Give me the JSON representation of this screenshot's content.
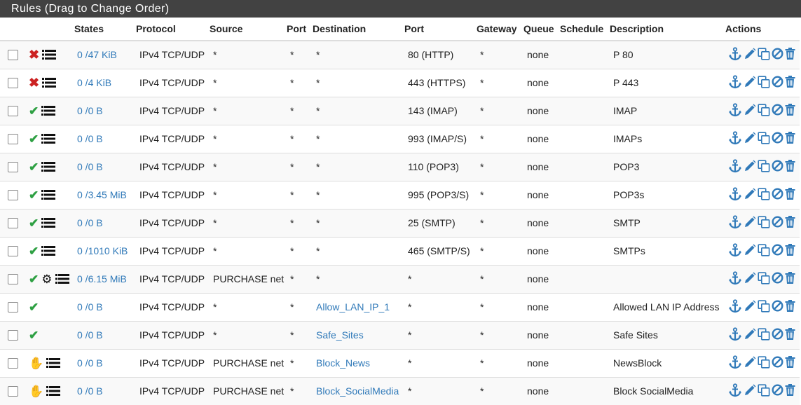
{
  "panel": {
    "title": "Rules (Drag to Change Order)"
  },
  "columns": [
    "States",
    "Protocol",
    "Source",
    "Port",
    "Destination",
    "Port",
    "Gateway",
    "Queue",
    "Schedule",
    "Description",
    "Actions"
  ],
  "icons": {
    "block": "x-mark-icon",
    "pass": "check-icon",
    "reject": "hand-icon",
    "log": "list-icon",
    "advanced": "gear-icon",
    "anchor": "anchor-icon",
    "edit": "pencil-icon",
    "copy": "copy-icon",
    "disable": "ban-icon",
    "delete": "trash-icon"
  },
  "colors": {
    "link": "#317ab9",
    "block": "#cc2222",
    "pass": "#2ea043",
    "reject": "#f0c000",
    "header_bg": "#424242"
  },
  "rules": [
    {
      "action": "block",
      "log": true,
      "gear": false,
      "states": "0 /47 KiB",
      "protocol": "IPv4 TCP/UDP",
      "source": "*",
      "sport": "*",
      "destination": "*",
      "dest_link": false,
      "dport": "80 (HTTP)",
      "gateway": "*",
      "queue": "none",
      "schedule": "",
      "description": "P 80"
    },
    {
      "action": "block",
      "log": true,
      "gear": false,
      "states": "0 /4 KiB",
      "protocol": "IPv4 TCP/UDP",
      "source": "*",
      "sport": "*",
      "destination": "*",
      "dest_link": false,
      "dport": "443 (HTTPS)",
      "gateway": "*",
      "queue": "none",
      "schedule": "",
      "description": "P 443"
    },
    {
      "action": "pass",
      "log": true,
      "gear": false,
      "states": "0 /0 B",
      "protocol": "IPv4 TCP/UDP",
      "source": "*",
      "sport": "*",
      "destination": "*",
      "dest_link": false,
      "dport": "143 (IMAP)",
      "gateway": "*",
      "queue": "none",
      "schedule": "",
      "description": "IMAP"
    },
    {
      "action": "pass",
      "log": true,
      "gear": false,
      "states": "0 /0 B",
      "protocol": "IPv4 TCP/UDP",
      "source": "*",
      "sport": "*",
      "destination": "*",
      "dest_link": false,
      "dport": "993 (IMAP/S)",
      "gateway": "*",
      "queue": "none",
      "schedule": "",
      "description": "IMAPs"
    },
    {
      "action": "pass",
      "log": true,
      "gear": false,
      "states": "0 /0 B",
      "protocol": "IPv4 TCP/UDP",
      "source": "*",
      "sport": "*",
      "destination": "*",
      "dest_link": false,
      "dport": "110 (POP3)",
      "gateway": "*",
      "queue": "none",
      "schedule": "",
      "description": "POP3"
    },
    {
      "action": "pass",
      "log": true,
      "gear": false,
      "states": "0 /3.45 MiB",
      "protocol": "IPv4 TCP/UDP",
      "source": "*",
      "sport": "*",
      "destination": "*",
      "dest_link": false,
      "dport": "995 (POP3/S)",
      "gateway": "*",
      "queue": "none",
      "schedule": "",
      "description": "POP3s"
    },
    {
      "action": "pass",
      "log": true,
      "gear": false,
      "states": "0 /0 B",
      "protocol": "IPv4 TCP/UDP",
      "source": "*",
      "sport": "*",
      "destination": "*",
      "dest_link": false,
      "dport": "25 (SMTP)",
      "gateway": "*",
      "queue": "none",
      "schedule": "",
      "description": "SMTP"
    },
    {
      "action": "pass",
      "log": true,
      "gear": false,
      "states": "0 /1010 KiB",
      "protocol": "IPv4 TCP/UDP",
      "source": "*",
      "sport": "*",
      "destination": "*",
      "dest_link": false,
      "dport": "465 (SMTP/S)",
      "gateway": "*",
      "queue": "none",
      "schedule": "",
      "description": "SMTPs"
    },
    {
      "action": "pass",
      "log": true,
      "gear": true,
      "states": "0 /6.15 MiB",
      "protocol": "IPv4 TCP/UDP",
      "source": "PURCHASE net",
      "sport": "*",
      "destination": "*",
      "dest_link": false,
      "dport": "*",
      "gateway": "*",
      "queue": "none",
      "schedule": "",
      "description": ""
    },
    {
      "action": "pass",
      "log": false,
      "gear": false,
      "states": "0 /0 B",
      "protocol": "IPv4 TCP/UDP",
      "source": "*",
      "sport": "*",
      "destination": "Allow_LAN_IP_1",
      "dest_link": true,
      "dport": "*",
      "gateway": "*",
      "queue": "none",
      "schedule": "",
      "description": "Allowed LAN IP Address"
    },
    {
      "action": "pass",
      "log": false,
      "gear": false,
      "states": "0 /0 B",
      "protocol": "IPv4 TCP/UDP",
      "source": "*",
      "sport": "*",
      "destination": "Safe_Sites",
      "dest_link": true,
      "dport": "*",
      "gateway": "*",
      "queue": "none",
      "schedule": "",
      "description": "Safe Sites"
    },
    {
      "action": "reject",
      "log": true,
      "gear": false,
      "states": "0 /0 B",
      "protocol": "IPv4 TCP/UDP",
      "source": "PURCHASE net",
      "sport": "*",
      "destination": "Block_News",
      "dest_link": true,
      "dport": "*",
      "gateway": "*",
      "queue": "none",
      "schedule": "",
      "description": "NewsBlock"
    },
    {
      "action": "reject",
      "log": true,
      "gear": false,
      "states": "0 /0 B",
      "protocol": "IPv4 TCP/UDP",
      "source": "PURCHASE net",
      "sport": "*",
      "destination": "Block_SocialMedia",
      "dest_link": true,
      "dport": "*",
      "gateway": "*",
      "queue": "none",
      "schedule": "",
      "description": "Block SocialMedia"
    }
  ]
}
